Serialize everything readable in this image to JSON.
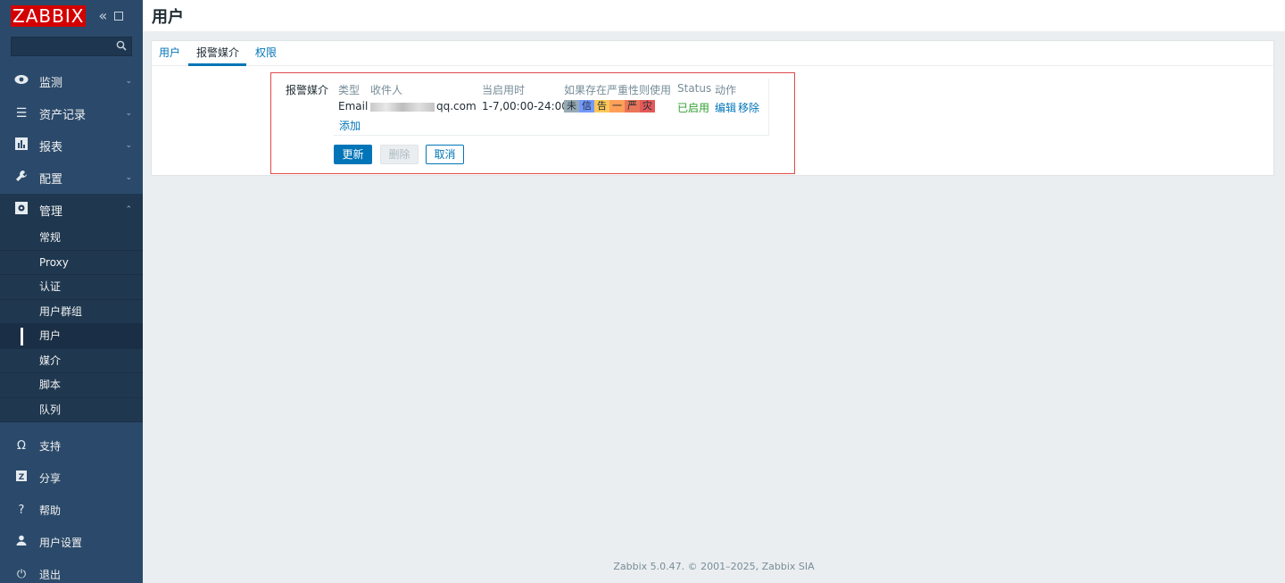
{
  "sidebar": {
    "logo": "ZABBIX",
    "collapse_glyph": "«",
    "search_value": "",
    "menu": [
      {
        "label": "监测",
        "icon": "eye-icon"
      },
      {
        "label": "资产记录",
        "icon": "list-icon"
      },
      {
        "label": "报表",
        "icon": "chart-icon"
      },
      {
        "label": "配置",
        "icon": "wrench-icon"
      },
      {
        "label": "管理",
        "icon": "gear-icon"
      }
    ],
    "submenu": [
      "常规",
      "Proxy",
      "认证",
      "用户群组",
      "用户",
      "媒介",
      "脚本",
      "队列"
    ],
    "bottom": [
      {
        "label": "支持",
        "icon": "headset-icon"
      },
      {
        "label": "分享",
        "icon": "share-icon"
      },
      {
        "label": "帮助",
        "icon": "help-icon"
      },
      {
        "label": "用户设置",
        "icon": "user-icon"
      },
      {
        "label": "退出",
        "icon": "power-icon"
      }
    ]
  },
  "header": {
    "title": "用户"
  },
  "tabs": [
    "用户",
    "报警媒介",
    "权限"
  ],
  "form": {
    "field_label": "报警媒介",
    "columns": [
      "类型",
      "收件人",
      "当启用时",
      "如果存在严重性则使用",
      "Status",
      "动作"
    ],
    "row": {
      "type": "Email",
      "recipient_suffix": "qq.com",
      "when_active": "1-7,00:00-24:00",
      "severities": [
        {
          "label": "未",
          "color": "#97aab3"
        },
        {
          "label": "信",
          "color": "#7499ff"
        },
        {
          "label": "告",
          "color": "#ffc859"
        },
        {
          "label": "一",
          "color": "#ffa059"
        },
        {
          "label": "严",
          "color": "#e97659"
        },
        {
          "label": "灾",
          "color": "#e45959"
        }
      ],
      "status": "已启用",
      "edit": "编辑",
      "remove": "移除"
    },
    "add_link": "添加",
    "buttons": {
      "update": "更新",
      "delete": "删除",
      "cancel": "取消"
    }
  },
  "footer": "Zabbix 5.0.47. © 2001–2025, Zabbix SIA"
}
